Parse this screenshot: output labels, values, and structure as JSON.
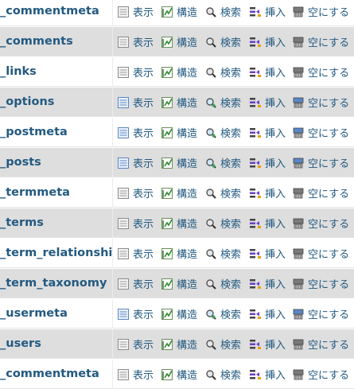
{
  "actions": {
    "browse": "表示",
    "structure": "構造",
    "search": "検索",
    "insert": "挿入",
    "empty": "空にする"
  },
  "rows": [
    {
      "name": "_commentmeta",
      "filled": false
    },
    {
      "name": "_comments",
      "filled": false
    },
    {
      "name": "_links",
      "filled": false
    },
    {
      "name": "_options",
      "filled": true
    },
    {
      "name": "_postmeta",
      "filled": true
    },
    {
      "name": "_posts",
      "filled": true
    },
    {
      "name": "_termmeta",
      "filled": false
    },
    {
      "name": "_terms",
      "filled": false
    },
    {
      "name": "_term_relationships",
      "filled": false
    },
    {
      "name": "_term_taxonomy",
      "filled": false
    },
    {
      "name": "_usermeta",
      "filled": true
    },
    {
      "name": "_users",
      "filled": false
    },
    {
      "name": "_commentmeta",
      "filled": false
    }
  ]
}
